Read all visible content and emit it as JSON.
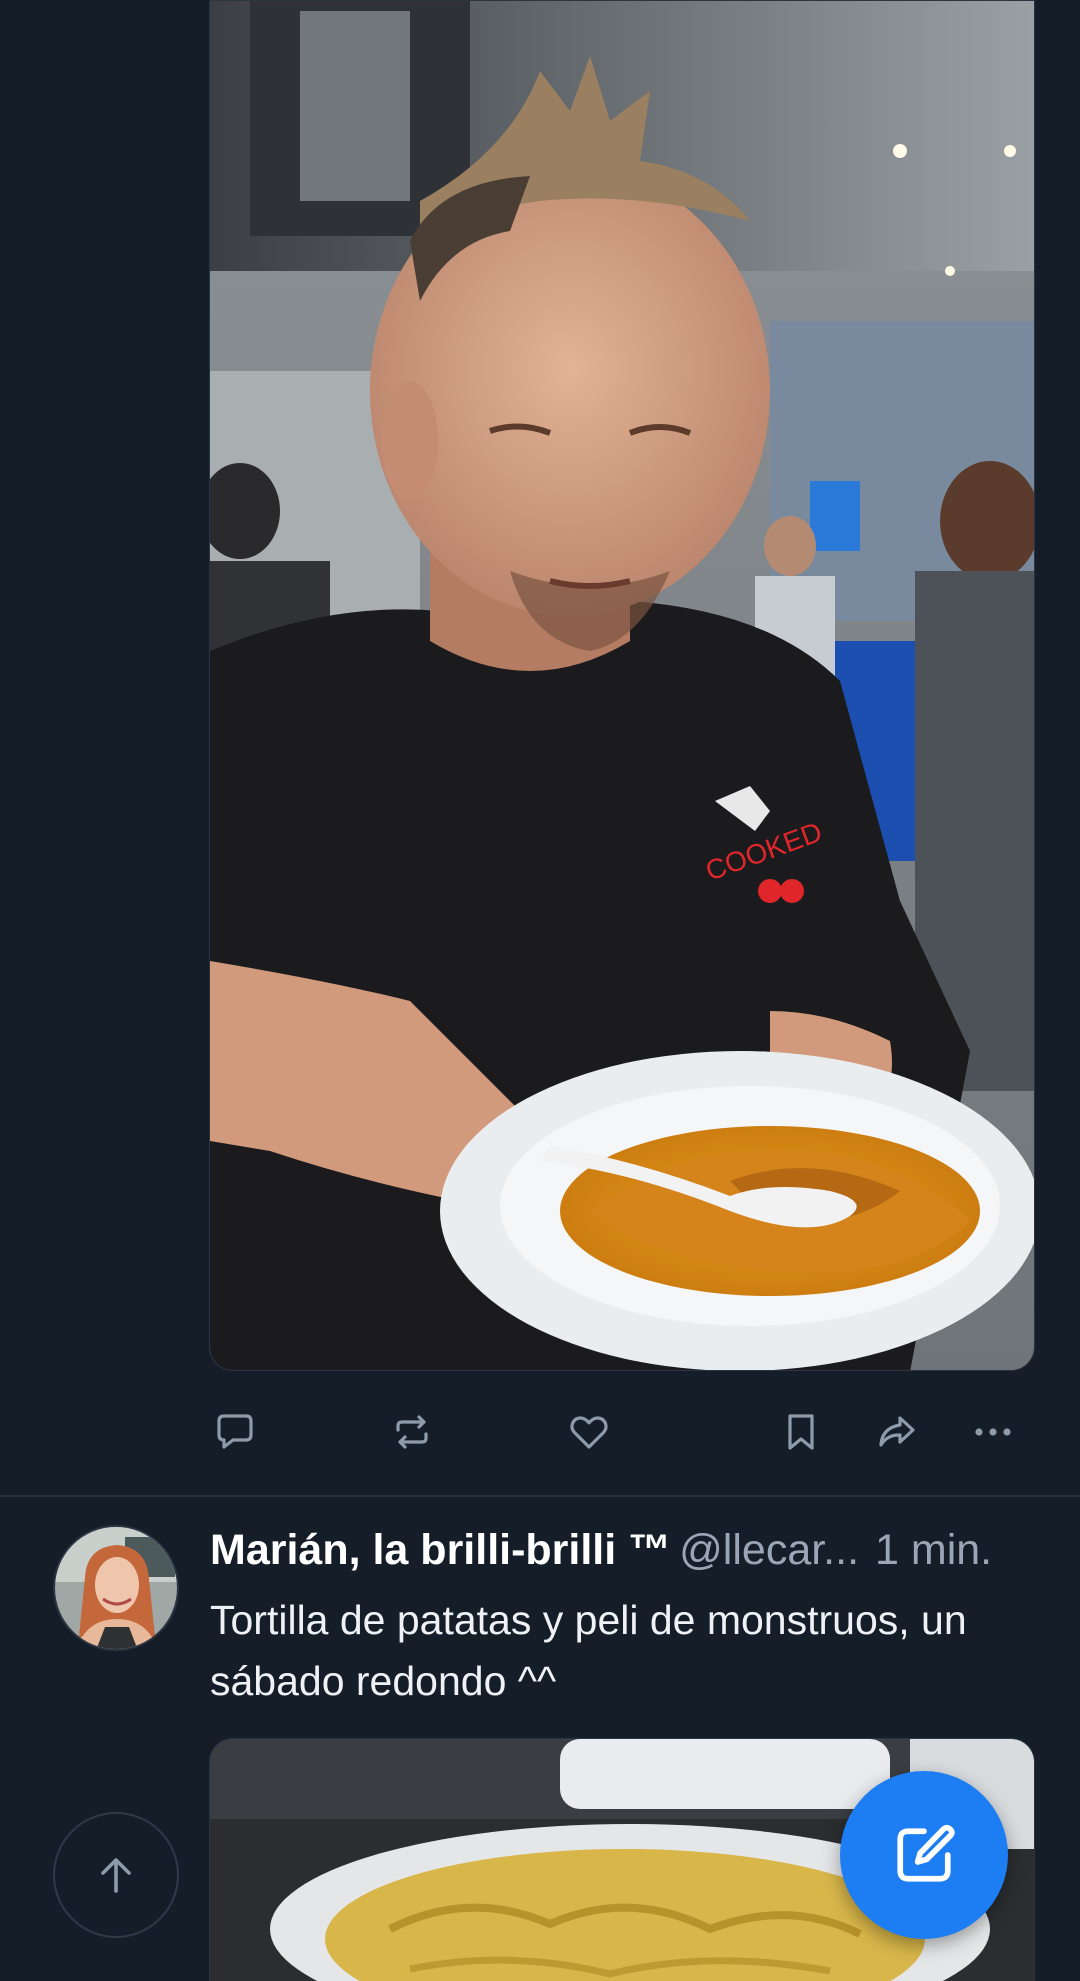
{
  "colors": {
    "background": "#151d28",
    "icon": "#8d9bab",
    "accent": "#1d7df2",
    "divider": "#243040"
  },
  "post_1": {
    "media_alt": "video frame: man with spiky hair tasting food from a plate",
    "actions": [
      {
        "icon": "reply-icon"
      },
      {
        "icon": "repost-icon"
      },
      {
        "icon": "like-icon"
      },
      {
        "icon": "bookmark-icon"
      },
      {
        "icon": "share-icon"
      },
      {
        "icon": "more-icon"
      }
    ]
  },
  "post_2": {
    "display_name": "Marián, la brilli-brilli ™",
    "handle": "@llecar...",
    "timestamp": "1 min.",
    "text": "Tortilla de patatas y peli de monstruos, un sábado redondo ^^",
    "media_alt": "photo: tortilla de patatas on a plate"
  },
  "floating": {
    "scroll_top_icon": "arrow-up-icon",
    "compose_icon": "compose-icon"
  }
}
